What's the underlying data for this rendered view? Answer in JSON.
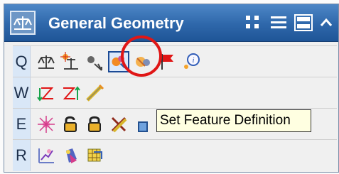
{
  "title": "General Geometry",
  "rows": [
    {
      "key": "Q",
      "tools": [
        "scale-balance-icon",
        "spark-balance-icon",
        "gear-arrow-icon",
        "feature-definition-icon",
        "feature-settings-icon",
        "red-flag-icon",
        "info-icon"
      ]
    },
    {
      "key": "W",
      "tools": [
        "green-z-arrow-icon",
        "red-z-arrow-icon",
        "pencil-ruler-icon"
      ]
    },
    {
      "key": "E",
      "tools": [
        "asterisk-icon",
        "open-lock-icon",
        "closed-lock-icon",
        "cross-ruler-icon",
        "small-box-icon"
      ]
    },
    {
      "key": "R",
      "tools": [
        "chart-star-icon",
        "paint-bucket-icon",
        "table-icon"
      ]
    }
  ],
  "tooltip": "Set Feature Definition",
  "colors": {
    "title_bar": "#2e67aa",
    "row_label": "#d9e7f7",
    "highlight": "#e01616",
    "tooltip_bg": "#ffffe1"
  }
}
